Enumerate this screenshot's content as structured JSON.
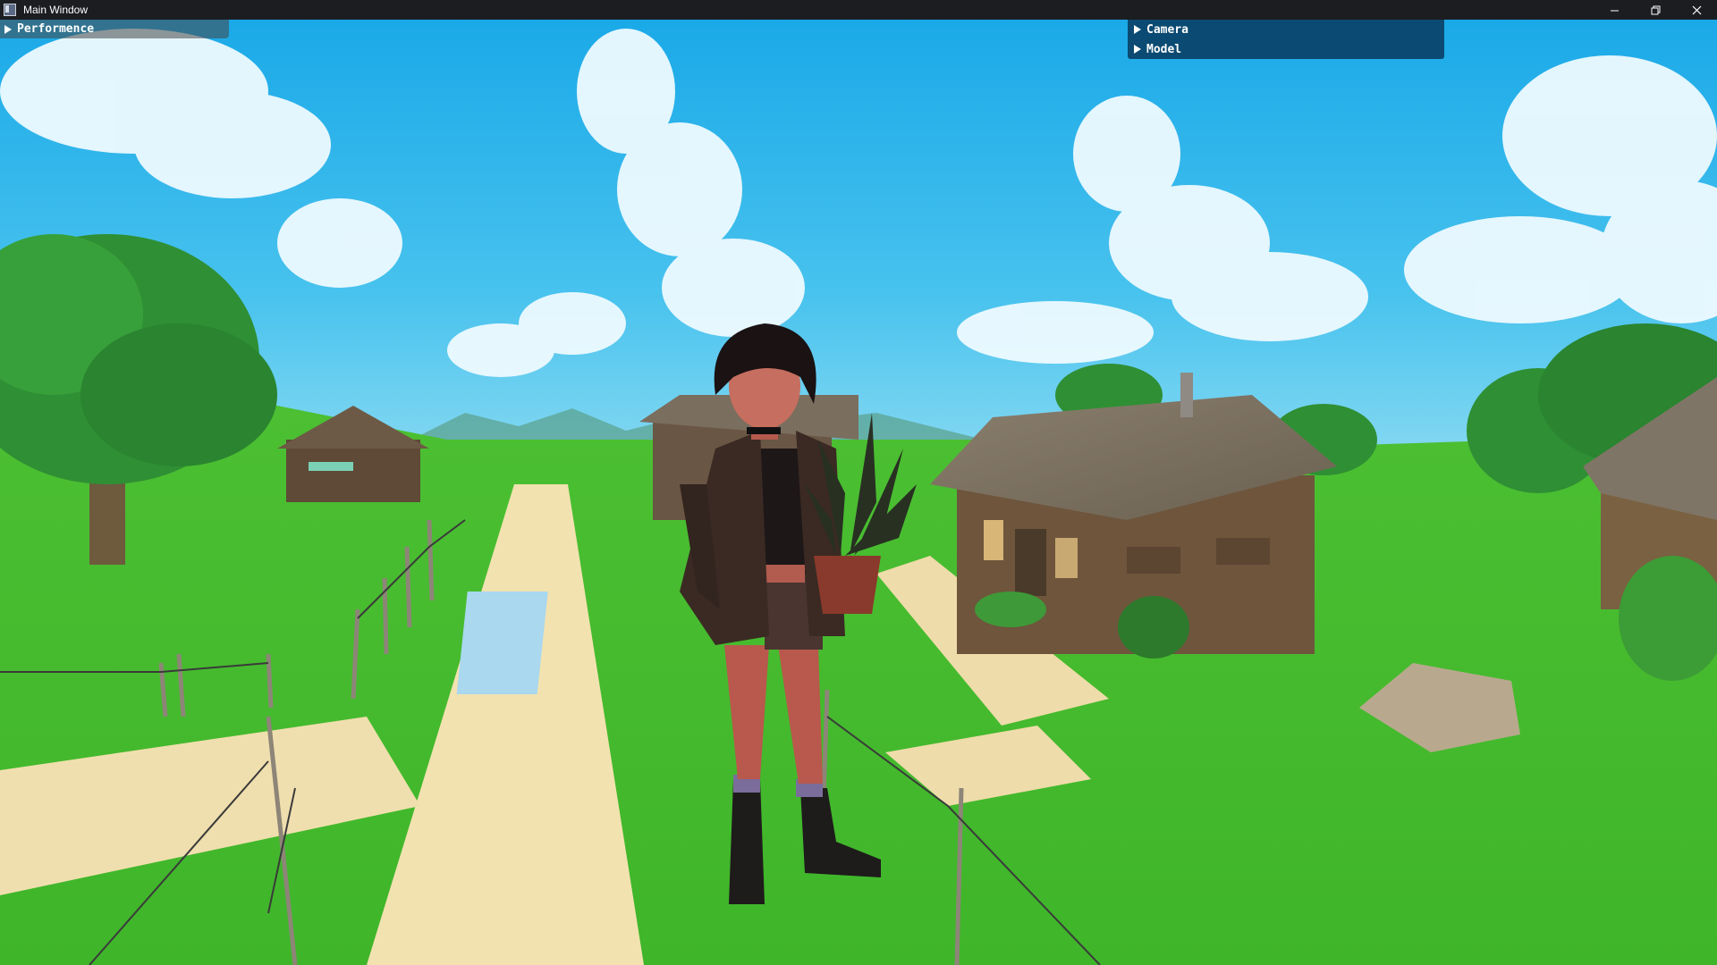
{
  "window": {
    "title": "Main Window",
    "controls": [
      "minimize",
      "restore",
      "close"
    ]
  },
  "panels": {
    "performance": {
      "label": "Performence",
      "expanded": false
    },
    "camera": {
      "label": "Camera",
      "expanded": false
    },
    "model": {
      "label": "Model",
      "expanded": false
    }
  },
  "colors": {
    "titlebar": "#1c1d21",
    "panel_blue": "#0b4a72"
  }
}
